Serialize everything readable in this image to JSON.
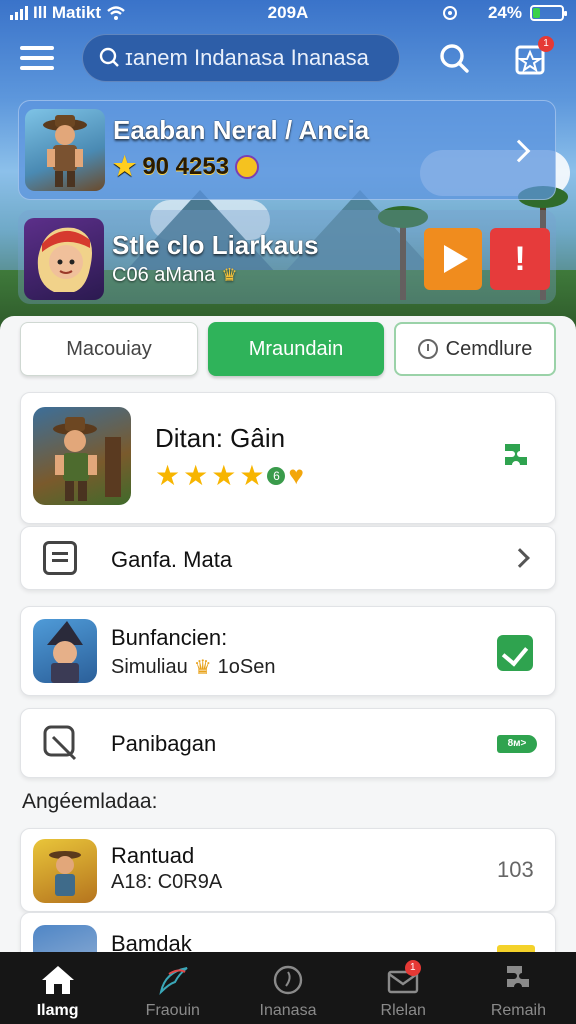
{
  "status_bar": {
    "carrier": "Ill Matikt",
    "time": "209A",
    "battery": "24%",
    "battery_level": 0.24
  },
  "top_bar": {
    "search_text": "ɪanem Indanasa Inanasa",
    "notification_count": "1"
  },
  "hero_cards": [
    {
      "title": "Eaaban Neral / Ancia",
      "rating_text": "90 4253"
    },
    {
      "title": "Stle clo Liarkaus",
      "subtitle": "C06 aMana"
    }
  ],
  "segments": [
    {
      "label": "Macouiay"
    },
    {
      "label": "Mraundain"
    },
    {
      "label": "Cemdlure"
    }
  ],
  "featured_game": {
    "title": "Ditan: Gâin",
    "star_count": 4,
    "rating_badge": "6"
  },
  "list_items": [
    {
      "label": "Ganfa. Mata"
    },
    {
      "label": "Bunfancien:",
      "sublabel_a": "Simuliau",
      "sublabel_b": "1oSen"
    },
    {
      "label": "Panibagan",
      "tag": "8м>"
    }
  ],
  "section_heading": "Angéemladaa:",
  "recent_items": [
    {
      "title": "Rantuad",
      "subtitle": "A18: C0R9A",
      "value": "103"
    },
    {
      "title": "Bamdak"
    }
  ],
  "bottom_nav": [
    {
      "label": "Ilamg",
      "active": true
    },
    {
      "label": "Fraouin",
      "active": false
    },
    {
      "label": "Inanasa",
      "active": false
    },
    {
      "label": "Rlelan",
      "active": false,
      "badge": "1"
    },
    {
      "label": "Remaih",
      "active": false
    }
  ],
  "colors": {
    "accent_green": "#2fb35a",
    "hero_blue": "#3a73c9",
    "alert_red": "#e63b3b",
    "play_orange": "#f08c1e"
  }
}
